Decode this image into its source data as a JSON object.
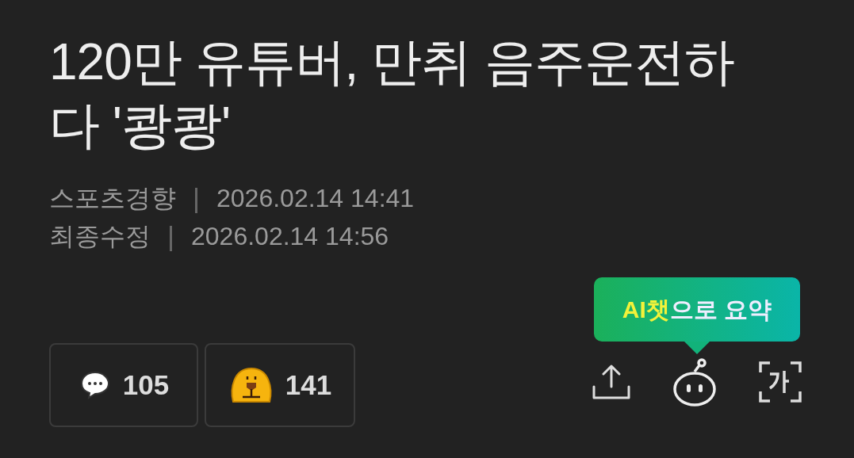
{
  "headline": "120만 유튜버, 만취 음주운전하다 '쾅쾅'",
  "meta": [
    {
      "label": "스포츠경향",
      "value": "2026.02.14 14:41"
    },
    {
      "label": "최종수정",
      "value": "2026.02.14 14:56"
    }
  ],
  "reactions": [
    {
      "kind": "comment",
      "count": "105"
    },
    {
      "kind": "emoji",
      "count": "141"
    }
  ],
  "tooltip": {
    "highlight": "AI챗",
    "rest": "으로 요약"
  },
  "actions": [
    {
      "kind": "share"
    },
    {
      "kind": "ai"
    },
    {
      "kind": "font"
    }
  ]
}
